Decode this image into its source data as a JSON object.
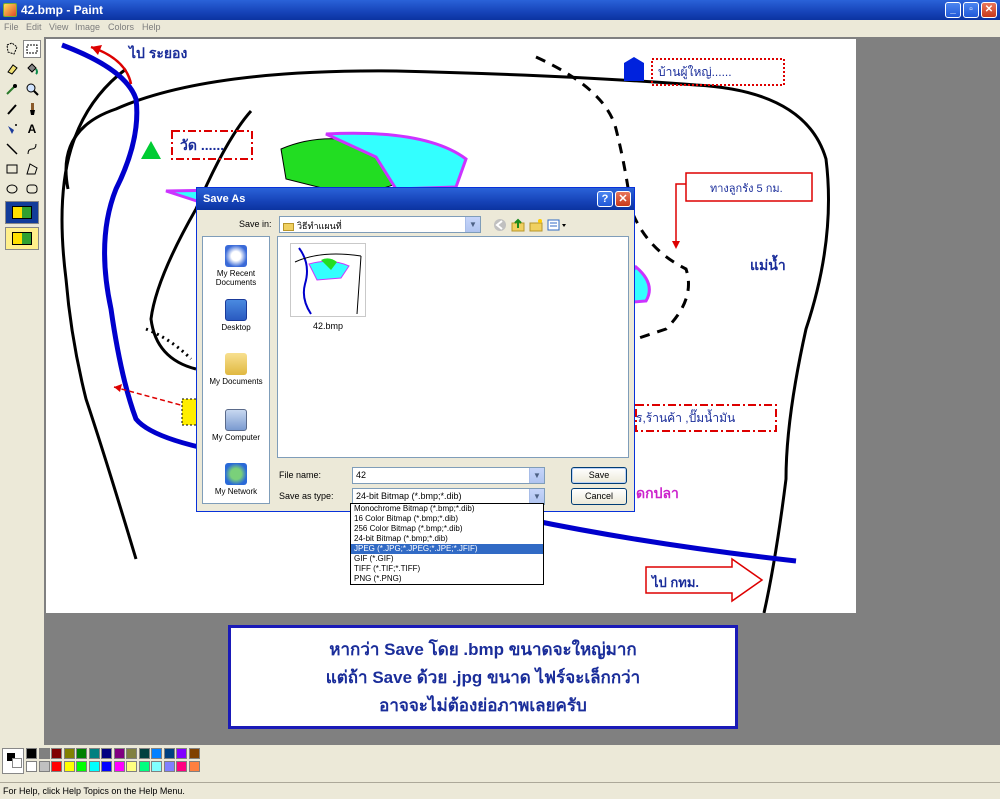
{
  "window": {
    "title": "42.bmp - Paint"
  },
  "menu": [
    "File",
    "Edit",
    "View",
    "Image",
    "Colors",
    "Help"
  ],
  "map": {
    "labels": {
      "to_rayong": "ไป ระยอง",
      "temple": "วัด ......",
      "village_head": "บ้านผู้ใหญ่......",
      "dirt_road": "ทางลูกรัง 5 กม.",
      "river": "แม่น้ำ",
      "shops": "ร,ร้านค้า ,ปั๊มน้ำมัน",
      "fish_pond": "ดกปลา",
      "to_bangkok": "ไป กทม."
    }
  },
  "caption": {
    "line1": "หากว่า Save โดย .bmp ขนาดจะใหญ่มาก",
    "line2": "แต่ถ้า Save ด้วย .jpg ขนาด ไฟร์จะเล็กกว่า",
    "line3": "อาจจะไม่ต้องย่อภาพเลยครับ"
  },
  "dialog": {
    "title": "Save As",
    "save_in_label": "Save in:",
    "save_in_value": "วิธีทำแผนที่",
    "places": [
      "My Recent Documents",
      "Desktop",
      "My Documents",
      "My Computer",
      "My Network"
    ],
    "file": {
      "name": "42.bmp"
    },
    "file_name_label": "File name:",
    "file_name_value": "42",
    "save_type_label": "Save as type:",
    "save_type_value": "24-bit Bitmap (*.bmp;*.dib)",
    "save_button": "Save",
    "cancel_button": "Cancel",
    "help_glyph": "?",
    "close_glyph": "✕"
  },
  "type_options": [
    "Monochrome Bitmap (*.bmp;*.dib)",
    "16 Color Bitmap (*.bmp;*.dib)",
    "256 Color Bitmap (*.bmp;*.dib)",
    "24-bit Bitmap (*.bmp;*.dib)",
    "JPEG (*.JPG;*.JPEG;*.JPE;*.JFIF)",
    "GIF (*.GIF)",
    "TIFF (*.TIF;*.TIFF)",
    "PNG (*.PNG)"
  ],
  "type_selected_index": 4,
  "palette": {
    "row1": [
      "#000000",
      "#808080",
      "#800000",
      "#808000",
      "#008000",
      "#008080",
      "#000080",
      "#800080",
      "#808040",
      "#004040",
      "#0080ff",
      "#004080",
      "#8000ff",
      "#804000"
    ],
    "row2": [
      "#ffffff",
      "#c0c0c0",
      "#ff0000",
      "#ffff00",
      "#00ff00",
      "#00ffff",
      "#0000ff",
      "#ff00ff",
      "#ffff80",
      "#00ff80",
      "#80ffff",
      "#8080ff",
      "#ff0080",
      "#ff8040"
    ]
  },
  "status": {
    "text": "For Help, click Help Topics on the Help Menu."
  },
  "icons": {
    "toolbox": [
      "free-select-icon",
      "rect-select-icon",
      "eraser-icon",
      "fill-icon",
      "color-picker-icon",
      "magnifier-icon",
      "pencil-icon",
      "brush-icon",
      "airbrush-icon",
      "text-icon",
      "line-icon",
      "curve-icon",
      "rectangle-icon",
      "polygon-icon",
      "ellipse-icon",
      "rounded-rect-icon"
    ]
  }
}
